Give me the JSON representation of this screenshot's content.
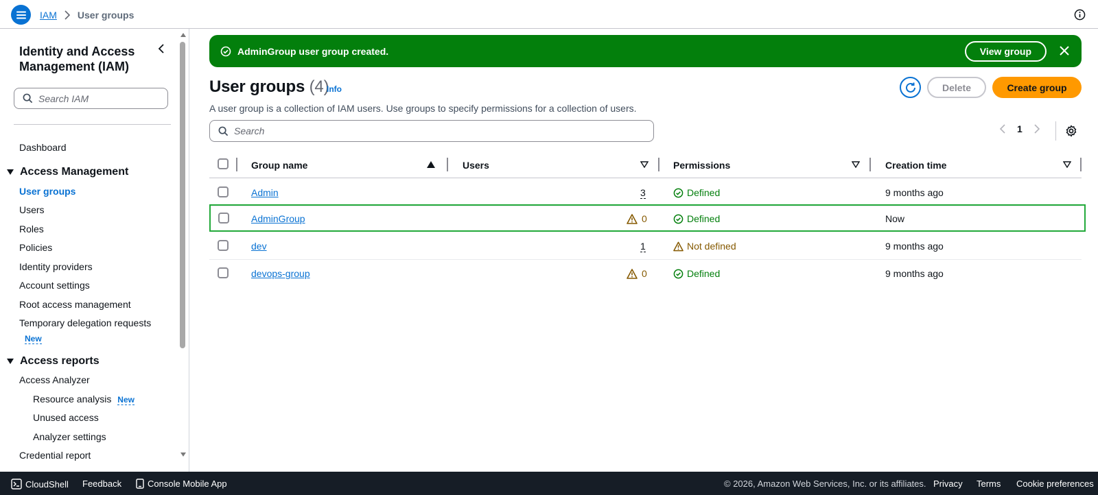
{
  "header": {
    "breadcrumb_root": "IAM",
    "breadcrumb_current": "User groups"
  },
  "sidebar": {
    "title": "Identity and Access Management (IAM)",
    "search_placeholder": "Search IAM",
    "dashboard": "Dashboard",
    "access_management": {
      "label": "Access Management",
      "items": [
        {
          "label": "User groups",
          "active": true
        },
        {
          "label": "Users"
        },
        {
          "label": "Roles"
        },
        {
          "label": "Policies"
        },
        {
          "label": "Identity providers"
        },
        {
          "label": "Account settings"
        },
        {
          "label": "Root access management"
        },
        {
          "label": "Temporary delegation requests",
          "badge": "New"
        }
      ]
    },
    "access_reports": {
      "label": "Access reports",
      "items": [
        {
          "label": "Access Analyzer"
        },
        {
          "label": "Resource analysis",
          "badge": "New"
        },
        {
          "label": "Unused access"
        },
        {
          "label": "Analyzer settings"
        },
        {
          "label": "Credential report"
        }
      ]
    }
  },
  "flash": {
    "message": "AdminGroup user group created.",
    "view_button": "View group"
  },
  "main": {
    "title": "User groups",
    "count": "(4)",
    "info": "Info",
    "description": "A user group is a collection of IAM users. Use groups to specify permissions for a collection of users.",
    "delete_button": "Delete",
    "create_button": "Create group",
    "search_placeholder": "Search",
    "page_number": "1"
  },
  "table": {
    "columns": [
      "Group name",
      "Users",
      "Permissions",
      "Creation time"
    ],
    "rows": [
      {
        "name": "Admin",
        "users": "3",
        "users_warning": false,
        "permissions": "Defined",
        "permissions_status": "ok",
        "created": "9 months ago",
        "highlighted": false
      },
      {
        "name": "AdminGroup",
        "users": "0",
        "users_warning": true,
        "permissions": "Defined",
        "permissions_status": "ok",
        "created": "Now",
        "highlighted": true
      },
      {
        "name": "dev",
        "users": "1",
        "users_warning": false,
        "permissions": "Not defined",
        "permissions_status": "warn",
        "created": "9 months ago",
        "highlighted": false
      },
      {
        "name": "devops-group",
        "users": "0",
        "users_warning": true,
        "permissions": "Defined",
        "permissions_status": "ok",
        "created": "9 months ago",
        "highlighted": false
      }
    ]
  },
  "footer": {
    "cloudshell": "CloudShell",
    "feedback": "Feedback",
    "mobile_app": "Console Mobile App",
    "copyright": "© 2026, Amazon Web Services, Inc. or its affiliates.",
    "privacy": "Privacy",
    "terms": "Terms",
    "cookie": "Cookie preferences"
  },
  "colors": {
    "link": "#0972d3",
    "success": "#037f0c",
    "warning": "#855900",
    "primary_button": "#ff9900",
    "footer_bg": "#161d26",
    "highlight_border": "#22a93a"
  }
}
